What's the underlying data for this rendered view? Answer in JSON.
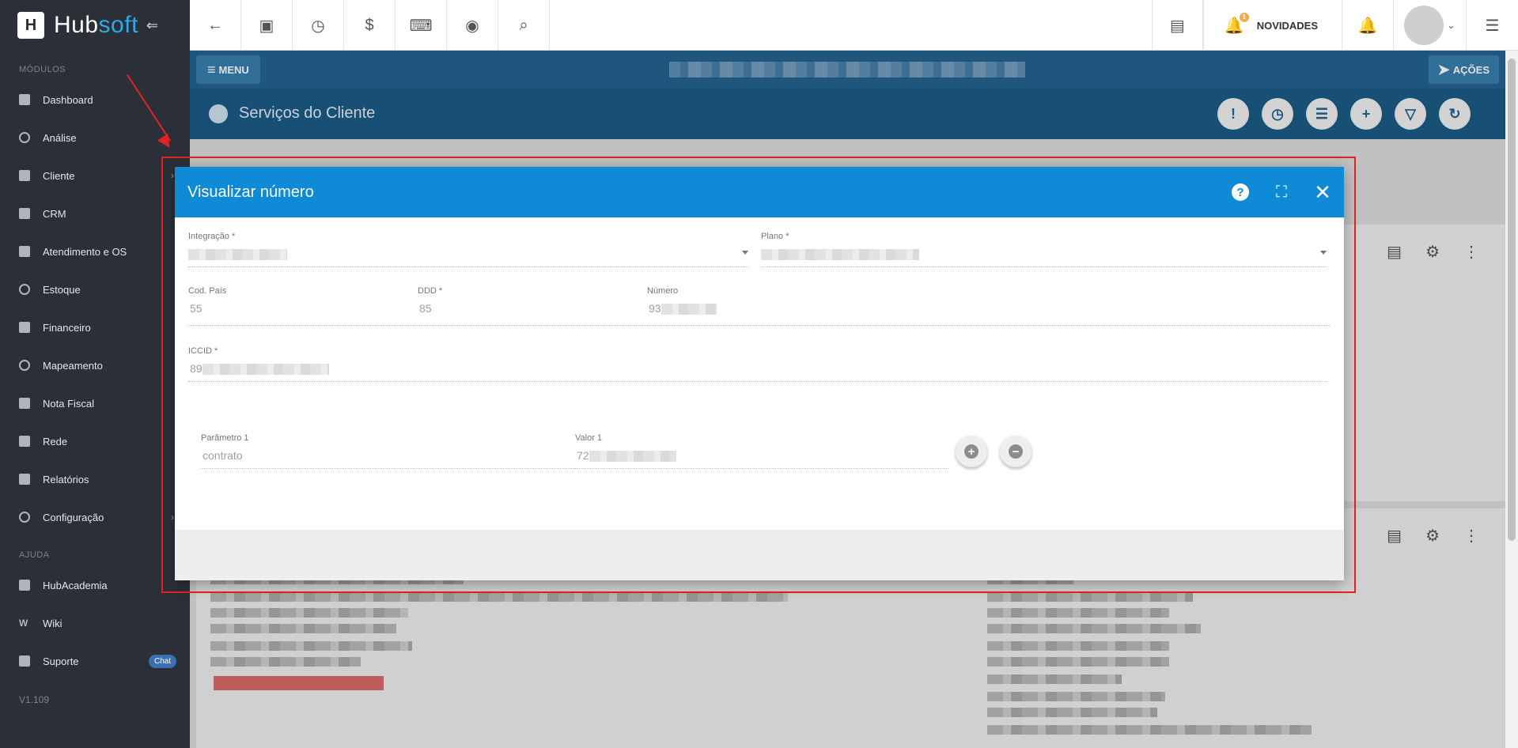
{
  "sidebar": {
    "brand_main": "Hub",
    "brand_accent": "soft",
    "section_modulos": "MÓDULOS",
    "items": [
      {
        "label": "Dashboard"
      },
      {
        "label": "Análise"
      },
      {
        "label": "Cliente"
      },
      {
        "label": "CRM"
      },
      {
        "label": "Atendimento e OS"
      },
      {
        "label": "Estoque"
      },
      {
        "label": "Financeiro"
      },
      {
        "label": "Mapeamento"
      },
      {
        "label": "Nota Fiscal"
      },
      {
        "label": "Rede"
      },
      {
        "label": "Relatórios"
      },
      {
        "label": "Configuração"
      }
    ],
    "section_ajuda": "AJUDA",
    "help_items": [
      {
        "label": "HubAcademia"
      },
      {
        "label": "Wiki"
      },
      {
        "label": "Suporte"
      }
    ],
    "chat_badge": "Chat",
    "version": "V1.109"
  },
  "topbar": {
    "novidades": "NOVIDADES",
    "notif_count": "1"
  },
  "bluebar": {
    "menu_label": "MENU",
    "acoes_label": "AÇÕES"
  },
  "pagehead": {
    "title": "Serviços do Cliente"
  },
  "modal": {
    "title": "Visualizar número",
    "integracao_label": "Integração *",
    "plano_label": "Plano *",
    "cod_pais_label": "Cod. País",
    "cod_pais_value": "55",
    "ddd_label": "DDD *",
    "ddd_value": "85",
    "numero_label": "Número",
    "numero_value": "93",
    "iccid_label": "ICCID *",
    "iccid_value": "89",
    "parametro_label": "Parâmetro 1",
    "parametro_value": "contrato",
    "valor_label": "Valor 1",
    "valor_value": "72"
  },
  "colors": {
    "sidebar_bg": "#2b3038",
    "modal_header": "#0e8ad6",
    "page_header": "#1b5a86",
    "annotation": "#e32222"
  }
}
